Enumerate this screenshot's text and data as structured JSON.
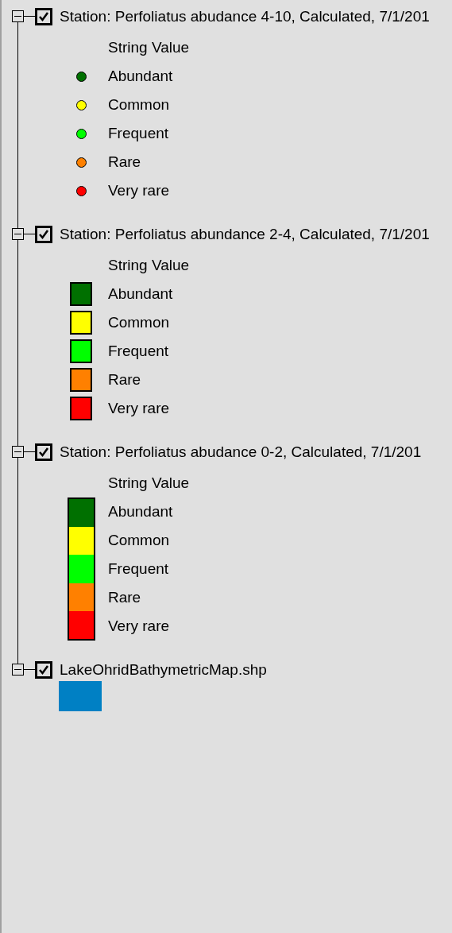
{
  "layers": [
    {
      "title": "Station: Perfoliatus abudance 4-10, Calculated, 7/1/201",
      "checked": true,
      "expanded": true,
      "legend": {
        "heading": "String Value",
        "kind": "point",
        "classes": [
          {
            "label": "Abundant",
            "color": "#007000"
          },
          {
            "label": "Common",
            "color": "#ffff00"
          },
          {
            "label": "Frequent",
            "color": "#00ff00"
          },
          {
            "label": "Rare",
            "color": "#ff8000"
          },
          {
            "label": "Very rare",
            "color": "#ff0000"
          }
        ]
      }
    },
    {
      "title": "Station: Perfoliatus abundance 2-4, Calculated, 7/1/201",
      "checked": true,
      "expanded": true,
      "legend": {
        "heading": "String Value",
        "kind": "fill",
        "classes": [
          {
            "label": "Abundant",
            "color": "#007000"
          },
          {
            "label": "Common",
            "color": "#ffff00"
          },
          {
            "label": "Frequent",
            "color": "#00ff00"
          },
          {
            "label": "Rare",
            "color": "#ff8000"
          },
          {
            "label": "Very rare",
            "color": "#ff0000"
          }
        ]
      }
    },
    {
      "title": "Station: Perfoliatus abudance 0-2, Calculated, 7/1/201",
      "checked": true,
      "expanded": true,
      "legend": {
        "heading": "String Value",
        "kind": "ramp",
        "classes": [
          {
            "label": "Abundant",
            "color": "#007000"
          },
          {
            "label": "Common",
            "color": "#ffff00"
          },
          {
            "label": "Frequent",
            "color": "#00ff00"
          },
          {
            "label": "Rare",
            "color": "#ff8000"
          },
          {
            "label": "Very rare",
            "color": "#ff0000"
          }
        ]
      }
    },
    {
      "title": "LakeOhridBathymetricMap.shp",
      "checked": true,
      "expanded": true,
      "legend": {
        "kind": "swatch",
        "classes": [
          {
            "color": "#0080c4"
          }
        ]
      }
    }
  ]
}
